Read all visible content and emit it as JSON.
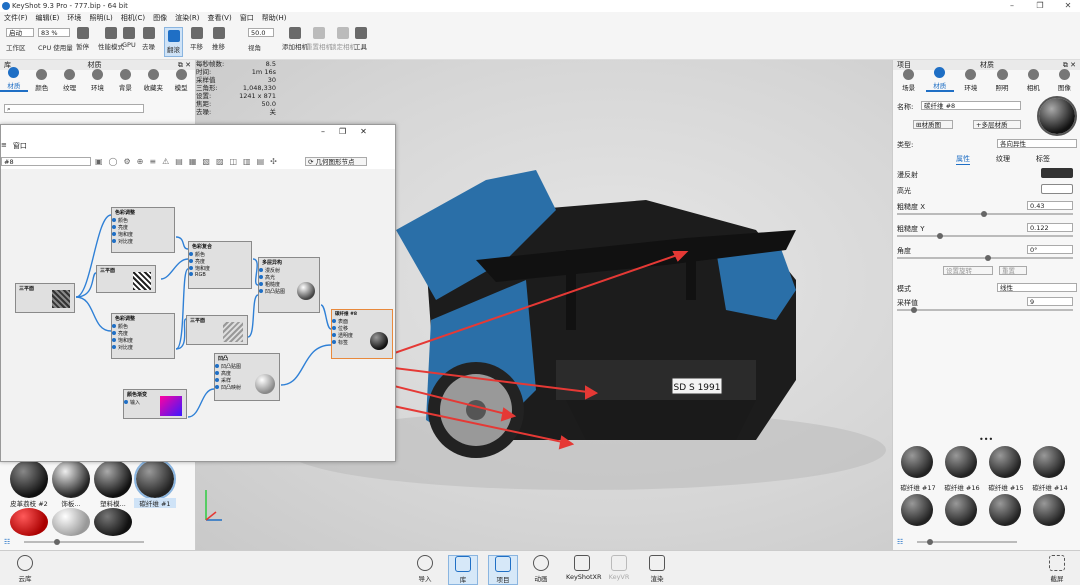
{
  "app": {
    "title": "KeyShot 9.3 Pro  -  777.bip  -  64 bit"
  },
  "menu": [
    "文件(F)",
    "编辑(E)",
    "环境",
    "照明(L)",
    "相机(C)",
    "图像",
    "渲染(R)",
    "查看(V)",
    "窗口",
    "帮助(H)"
  ],
  "toolbar": {
    "workspace_select": "启动",
    "zoom_select": "83 %",
    "fov_value": "50.0",
    "buttons": [
      "工作区",
      "CPU 使用量",
      "暂停",
      "性能模式",
      "GPU",
      "去噪",
      "翻滚",
      "平移",
      "推移",
      "视角",
      "添加相机",
      "重置相机",
      "锁定相机",
      "工具"
    ]
  },
  "left_panel": {
    "header": "库",
    "subheader": "材质",
    "tabs": [
      "材质",
      "颜色",
      "纹理",
      "环境",
      "背景",
      "收藏夹",
      "模型"
    ],
    "search_placeholder": "",
    "materials": [
      "皮革荔枝 #2",
      "饰板...",
      "塑料模...",
      "碳纤维 #1"
    ]
  },
  "stats": [
    {
      "k": "每秒帧数:",
      "v": "8.5"
    },
    {
      "k": "时间:",
      "v": "1m 16s"
    },
    {
      "k": "采样值",
      "v": "30"
    },
    {
      "k": "三角形:",
      "v": "1,048,330"
    },
    {
      "k": "设置:",
      "v": "1241 x 871"
    },
    {
      "k": "焦距:",
      "v": "50.0"
    },
    {
      "k": "去噪:",
      "v": "关"
    }
  ],
  "node_window": {
    "menu": [
      "窗口"
    ],
    "mat_field": "#8",
    "geom_button": "几何图形节点",
    "nodes": [
      {
        "title": "色彩调整",
        "ports": [
          "颜色",
          "亮度",
          "饱和度",
          "对比度"
        ]
      },
      {
        "title": "三平面",
        "ports": []
      },
      {
        "title": "色彩复合",
        "ports": [
          "颜色",
          "亮度",
          "饱和度",
          "RGB"
        ]
      },
      {
        "title": "多层异构",
        "ports": [
          "漫反射",
          "高光",
          "粗糙度",
          "凹凸贴图"
        ]
      },
      {
        "title": "三平面",
        "ports": []
      },
      {
        "title": "色彩调整",
        "ports": [
          "颜色",
          "亮度",
          "饱和度",
          "对比度"
        ]
      },
      {
        "title": "三平面",
        "ports": []
      },
      {
        "title": "碳纤维 #8",
        "ports": [
          "表面",
          "位移",
          "透明度",
          "标签"
        ]
      },
      {
        "title": "凹凸",
        "ports": [
          "凹凸贴图",
          "高度",
          "采样",
          "凹凸映射"
        ]
      },
      {
        "title": "颜色渐变",
        "ports": [
          "输入"
        ]
      }
    ]
  },
  "right_panel": {
    "header": "项目",
    "subheader": "材质",
    "tabs": [
      "场景",
      "材质",
      "环境",
      "照明",
      "相机",
      "图像"
    ],
    "name_label": "名称:",
    "name_value": "碳纤维 #8",
    "graph_button": "材质图",
    "multi_button": "多层材质",
    "type_label": "类型:",
    "type_value": "各向异性",
    "subtabs": [
      "属性",
      "纹理",
      "标签"
    ],
    "diffuse_label": "漫反射",
    "specular_label": "高光",
    "rough_x_label": "粗糙度 X",
    "rough_x_value": "0.43",
    "rough_y_label": "粗糙度 Y",
    "rough_y_value": "0.122",
    "angle_label": "角度",
    "angle_value": "0°",
    "btn_set": "设置旋转",
    "btn_reset": "重置",
    "mode_label": "模式",
    "mode_value": "线性",
    "samples_label": "采样值",
    "samples_value": "9",
    "materials": [
      "碳纤维 #17",
      "碳纤维 #16",
      "碳纤维 #15",
      "碳纤维 #14"
    ],
    "plate": "SD S 1991"
  },
  "bottom_bar": {
    "left": "云库",
    "items": [
      "导入",
      "库",
      "项目",
      "动画",
      "KeyShotXR",
      "KeyVR",
      "渲染"
    ],
    "right": "截屏"
  },
  "colors": {
    "accent": "#1f6fc5",
    "car_blue": "#2a6fa8",
    "arrow": "#e53935"
  }
}
